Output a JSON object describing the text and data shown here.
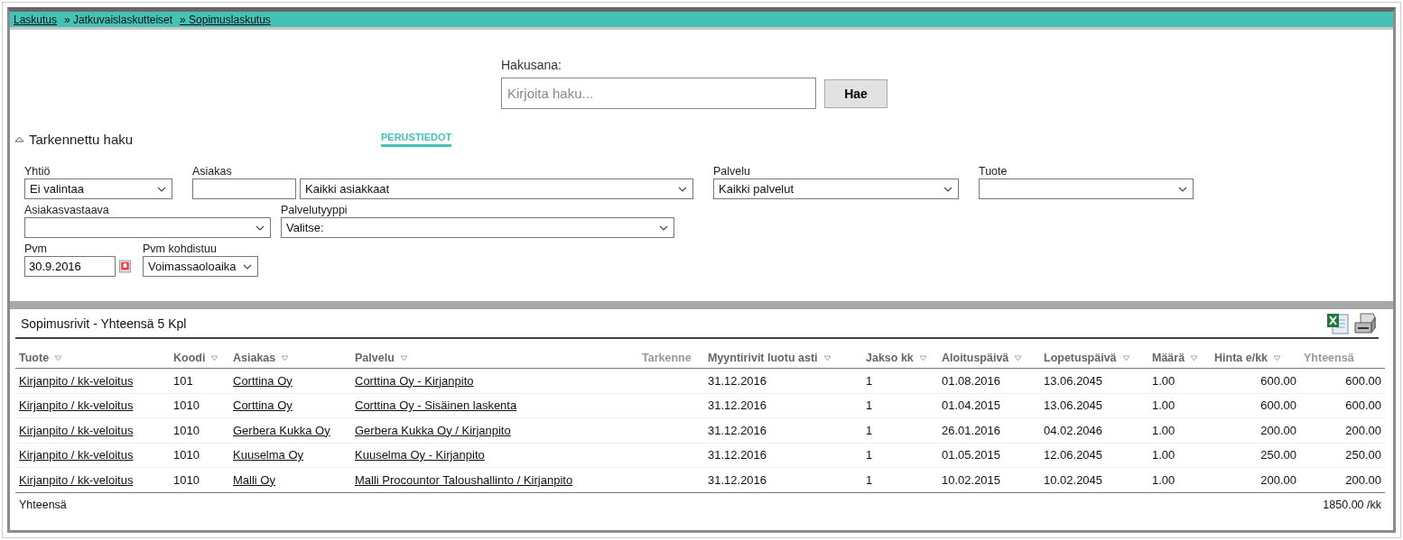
{
  "breadcrumb": [
    {
      "label": "Laskutus",
      "kind": "link"
    },
    {
      "label": "» Jatkuvaislaskutteiset",
      "kind": "text"
    },
    {
      "label": "» Sopimuslaskutus",
      "kind": "link"
    }
  ],
  "search": {
    "label": "Hakusana:",
    "placeholder": "Kirjoita haku...",
    "button": "Hae"
  },
  "advanced": {
    "label": "Tarkennettu haku",
    "expanded": true
  },
  "tabs": [
    {
      "label": "PERUSTIEDOT",
      "selected": true
    }
  ],
  "filters": [
    [
      {
        "label": "Yhtiö",
        "kind": "select",
        "value": "Ei valintaa"
      },
      {
        "label": "Asiakas",
        "kind": "combo",
        "select_value": "Kaikki asiakkaat"
      },
      {
        "label": "Palvelu",
        "kind": "select",
        "value": "Kaikki palvelut"
      },
      {
        "label": "Tuote",
        "kind": "select"
      }
    ],
    [
      {
        "label": "Asiakasvastaava",
        "kind": "select"
      },
      {
        "label": "Palvelutyyppi",
        "kind": "select",
        "value": "Valitse:"
      }
    ],
    [
      {
        "label": "Pvm",
        "kind": "date",
        "value": "30.9.2016"
      },
      {
        "label": "Pvm kohdistuu",
        "kind": "select",
        "value": "Voimassaoloaika"
      }
    ]
  ],
  "results": {
    "title": "Sopimusrivit - Yhteensä 5 Kpl",
    "columns": [
      {
        "label": "Tuote",
        "sortable": true,
        "kind": "link"
      },
      {
        "label": "Koodi",
        "sortable": true,
        "kind": "text"
      },
      {
        "label": "Asiakas",
        "sortable": true,
        "kind": "link"
      },
      {
        "label": "Palvelu",
        "sortable": true,
        "kind": "link"
      },
      {
        "label": "Tarkenne",
        "sortable": false,
        "kind": "text"
      },
      {
        "label": "Myyntirivit luotu asti",
        "sortable": true,
        "kind": "text"
      },
      {
        "label": "Jakso kk",
        "sortable": true,
        "kind": "text"
      },
      {
        "label": "Aloituspäivä",
        "sortable": true,
        "kind": "text"
      },
      {
        "label": "Lopetuspäivä",
        "sortable": true,
        "kind": "text"
      },
      {
        "label": "Määrä",
        "sortable": true,
        "kind": "text"
      },
      {
        "label": "Hinta e/kk",
        "sortable": true,
        "kind": "number"
      },
      {
        "label": "Yhteensä",
        "sortable": false,
        "kind": "number"
      }
    ],
    "rows": [
      [
        "Kirjanpito / kk-veloitus",
        "101",
        "Corttina Oy",
        "Corttina Oy - Kirjanpito",
        "",
        "31.12.2016",
        "1",
        "01.08.2016",
        "13.06.2045",
        "1.00",
        "600.00",
        "600.00"
      ],
      [
        "Kirjanpito / kk-veloitus",
        "1010",
        "Corttina Oy",
        "Corttina Oy - Sisäinen laskenta",
        "",
        "31.12.2016",
        "1",
        "01.04.2015",
        "13.06.2045",
        "1.00",
        "600.00",
        "600.00"
      ],
      [
        "Kirjanpito / kk-veloitus",
        "1010",
        "Gerbera Kukka Oy",
        "Gerbera Kukka Oy / Kirjanpito",
        "",
        "31.12.2016",
        "1",
        "26.01.2016",
        "04.02.2046",
        "1.00",
        "200.00",
        "200.00"
      ],
      [
        "Kirjanpito / kk-veloitus",
        "1010",
        "Kuuselma Oy",
        "Kuuselma Oy - Kirjanpito",
        "",
        "31.12.2016",
        "1",
        "01.05.2015",
        "12.06.2045",
        "1.00",
        "250.00",
        "250.00"
      ],
      [
        "Kirjanpito / kk-veloitus",
        "1010",
        "Malli Oy",
        "Malli Procountor Taloushallinto / Kirjanpito",
        "",
        "31.12.2016",
        "1",
        "10.02.2015",
        "10.02.2045",
        "1.00",
        "200.00",
        "200.00"
      ]
    ],
    "footer": {
      "label": "Yhteensä",
      "total": "1850.00 /kk"
    }
  }
}
